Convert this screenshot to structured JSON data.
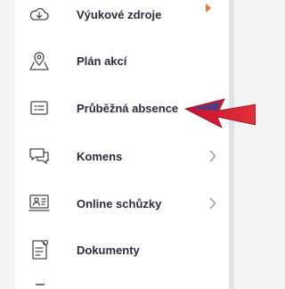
{
  "sidebar": {
    "items": [
      {
        "label": "Výukové zdroje",
        "icon": "cloud-icon",
        "has_chevron": false
      },
      {
        "label": "Plán akcí",
        "icon": "map-pin-icon",
        "has_chevron": false
      },
      {
        "label": "Průběžná absence",
        "icon": "attendance-list-icon",
        "has_chevron": false
      },
      {
        "label": "Komens",
        "icon": "chat-bubbles-icon",
        "has_chevron": true
      },
      {
        "label": "Online schůzky",
        "icon": "video-meeting-icon",
        "has_chevron": true
      },
      {
        "label": "Dokumenty",
        "icon": "document-icon",
        "has_chevron": false
      }
    ]
  },
  "annotation": {
    "type": "red-arrow",
    "points_to": "Průběžná absence",
    "color": "#d2232a"
  },
  "colors": {
    "label_text": "#2f2a40",
    "icon_stroke": "#4a4a4a",
    "sidebar_bg": "#ffffff",
    "rail": "#e1e2e4",
    "accent_top": "#e07a3e"
  }
}
